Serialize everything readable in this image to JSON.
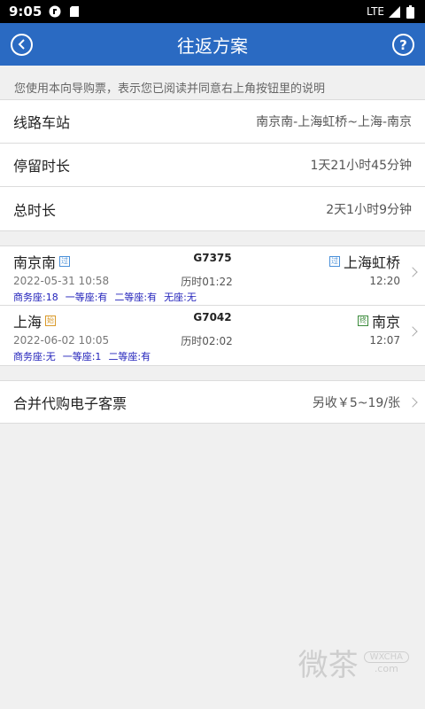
{
  "status_bar": {
    "time": "9:05",
    "network": "LTE"
  },
  "nav": {
    "title": "往返方案",
    "help_label": "?"
  },
  "notice": "您使用本向导购票，表示您已阅读并同意右上角按钮里的说明",
  "info": [
    {
      "label": "线路车站",
      "value": "南京南-上海虹桥~上海-南京"
    },
    {
      "label": "停留时长",
      "value": "1天21小时45分钟"
    },
    {
      "label": "总时长",
      "value": "2天1小时9分钟"
    }
  ],
  "trains": [
    {
      "from": "南京南",
      "from_tag": "过",
      "train_no": "G7375",
      "to_tag": "过",
      "to": "上海虹桥",
      "depart": "2022-05-31 10:58",
      "duration": "历时01:22",
      "arrive": "12:20",
      "seats": [
        "商务座:18",
        "一等座:有",
        "二等座:有",
        "无座:无"
      ]
    },
    {
      "from": "上海",
      "from_tag": "始",
      "train_no": "G7042",
      "to_tag": "终",
      "to": "南京",
      "depart": "2022-06-02 10:05",
      "duration": "历时02:02",
      "arrive": "12:07",
      "seats": [
        "商务座:无",
        "一等座:1",
        "二等座:有"
      ]
    }
  ],
  "merge": {
    "label": "合并代购电子客票",
    "value": "另收￥5~19/张"
  },
  "watermark": {
    "brand": "微茶",
    "tag": "WXCHA",
    "site": ".com"
  }
}
